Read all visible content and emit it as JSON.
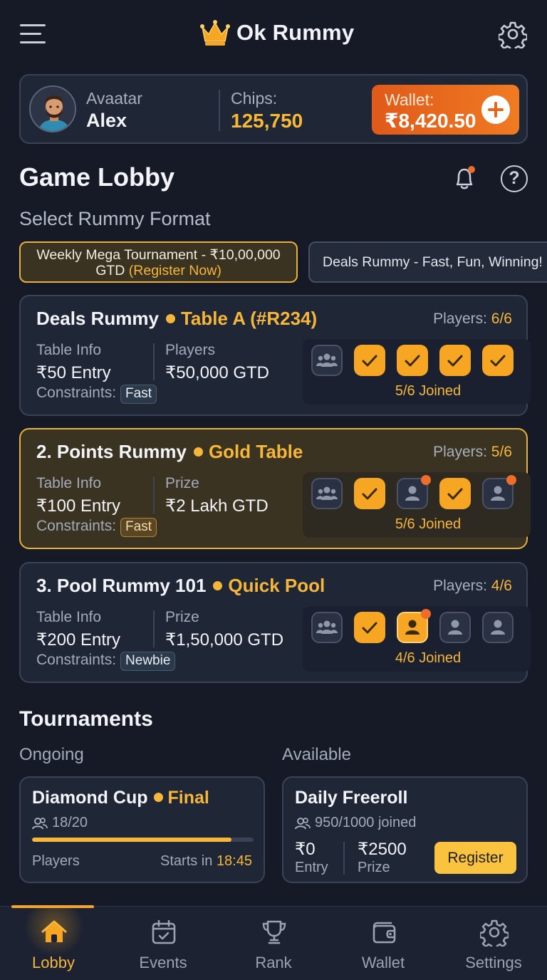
{
  "header": {
    "title": "Ok Rummy",
    "icons": {
      "menu": "menu-icon",
      "crown": "crown-icon",
      "settings": "gear-icon"
    }
  },
  "profile": {
    "avatar_label": "Avaatar",
    "name": "Alex",
    "chips_label": "Chips:",
    "chips_value": "125,750",
    "wallet_label": "Wallet:",
    "wallet_value": "₹8,420.50"
  },
  "lobby": {
    "title": "Game Lobby",
    "select_label": "Select Rummy Format",
    "promos": [
      {
        "text_main": "Weekly Mega Tournament - ₹10,00,000 GTD",
        "text_highlight": "(Register Now)"
      },
      {
        "text_main": "Deals Rummy - Fast, Fun, Winning!"
      }
    ]
  },
  "tables": [
    {
      "name": "Deals Rummy",
      "sub": "Table A (#R234)",
      "players_label": "Players:",
      "players_value": "6/6",
      "info_label": "Table Info",
      "entry": "₹50 Entry",
      "right_label": "Players",
      "right_value": "₹50,000 GTD",
      "constraints_label": "Constraints:",
      "constraint": "Fast",
      "seats": [
        "group",
        "ok",
        "ok",
        "ok",
        "ok"
      ],
      "status": "5/6 Joined"
    },
    {
      "name": "2. Points Rummy",
      "sub": "Gold Table",
      "players_label": "Players:",
      "players_value": "5/6",
      "info_label": "Table Info",
      "entry": "₹100 Entry",
      "right_label": "Prize",
      "right_value": "₹2 Lakh GTD",
      "constraints_label": "Constraints:",
      "constraint": "Fast",
      "seats": [
        "group",
        "ok",
        "empty-badge",
        "ok",
        "empty-badge"
      ],
      "status": "5/6 Joined"
    },
    {
      "name": "3. Pool Rummy 101",
      "sub": "Quick Pool",
      "players_label": "Players:",
      "players_value": "4/6",
      "info_label": "Table Info",
      "entry": "₹200 Entry",
      "right_label": "Prize",
      "right_value": "₹1,50,000 GTD",
      "constraints_label": "Constraints:",
      "constraint": "Newbie",
      "seats": [
        "group",
        "ok",
        "me-badge",
        "empty",
        "empty"
      ],
      "status": "4/6 Joined"
    }
  ],
  "tournaments": {
    "title": "Tournaments",
    "ongoing_label": "Ongoing",
    "available_label": "Available",
    "ongoing": {
      "name": "Diamond Cup",
      "stage": "Final",
      "count": "18/20",
      "progress": 0.9,
      "players_label": "Players",
      "starts_label": "Starts in",
      "starts_value": "18:45"
    },
    "available": {
      "name": "Daily Freeroll",
      "joined": "950/1000 joined",
      "entry_value": "₹0",
      "entry_label": "Entry",
      "prize_value": "₹2500",
      "prize_label": "Prize",
      "register": "Register"
    }
  },
  "nav": [
    {
      "label": "Lobby",
      "icon": "home-icon",
      "active": true
    },
    {
      "label": "Events",
      "icon": "calendar-icon"
    },
    {
      "label": "Rank",
      "icon": "trophy-icon"
    },
    {
      "label": "Wallet",
      "icon": "wallet-icon"
    },
    {
      "label": "Settings",
      "icon": "gear-icon"
    }
  ],
  "colors": {
    "accent": "#f6b63a",
    "wallet": "#e8651c",
    "bg": "#151a26",
    "card": "#1f2636"
  }
}
